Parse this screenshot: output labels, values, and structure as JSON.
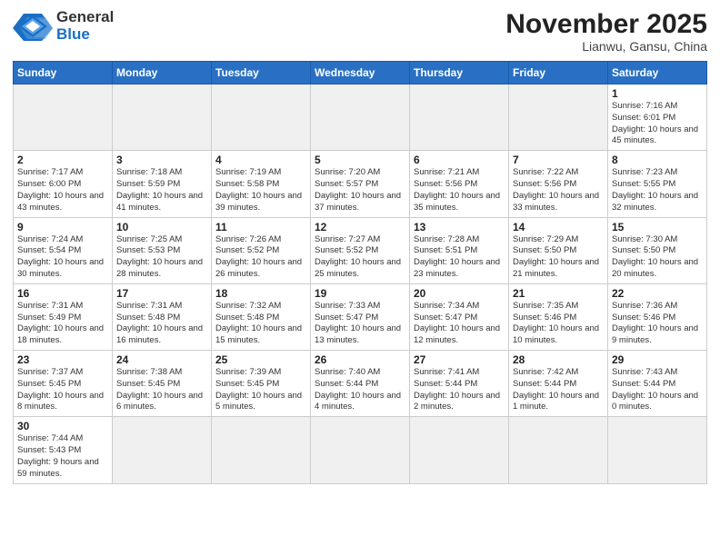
{
  "logo": {
    "general": "General",
    "blue": "Blue"
  },
  "header": {
    "month": "November 2025",
    "location": "Lianwu, Gansu, China"
  },
  "weekdays": [
    "Sunday",
    "Monday",
    "Tuesday",
    "Wednesday",
    "Thursday",
    "Friday",
    "Saturday"
  ],
  "days": [
    {
      "date": null,
      "info": ""
    },
    {
      "date": null,
      "info": ""
    },
    {
      "date": null,
      "info": ""
    },
    {
      "date": null,
      "info": ""
    },
    {
      "date": null,
      "info": ""
    },
    {
      "date": null,
      "info": ""
    },
    {
      "date": 1,
      "info": "Sunrise: 7:16 AM\nSunset: 6:01 PM\nDaylight: 10 hours and 45 minutes."
    },
    {
      "date": 2,
      "info": "Sunrise: 7:17 AM\nSunset: 6:00 PM\nDaylight: 10 hours and 43 minutes."
    },
    {
      "date": 3,
      "info": "Sunrise: 7:18 AM\nSunset: 5:59 PM\nDaylight: 10 hours and 41 minutes."
    },
    {
      "date": 4,
      "info": "Sunrise: 7:19 AM\nSunset: 5:58 PM\nDaylight: 10 hours and 39 minutes."
    },
    {
      "date": 5,
      "info": "Sunrise: 7:20 AM\nSunset: 5:57 PM\nDaylight: 10 hours and 37 minutes."
    },
    {
      "date": 6,
      "info": "Sunrise: 7:21 AM\nSunset: 5:56 PM\nDaylight: 10 hours and 35 minutes."
    },
    {
      "date": 7,
      "info": "Sunrise: 7:22 AM\nSunset: 5:56 PM\nDaylight: 10 hours and 33 minutes."
    },
    {
      "date": 8,
      "info": "Sunrise: 7:23 AM\nSunset: 5:55 PM\nDaylight: 10 hours and 32 minutes."
    },
    {
      "date": 9,
      "info": "Sunrise: 7:24 AM\nSunset: 5:54 PM\nDaylight: 10 hours and 30 minutes."
    },
    {
      "date": 10,
      "info": "Sunrise: 7:25 AM\nSunset: 5:53 PM\nDaylight: 10 hours and 28 minutes."
    },
    {
      "date": 11,
      "info": "Sunrise: 7:26 AM\nSunset: 5:52 PM\nDaylight: 10 hours and 26 minutes."
    },
    {
      "date": 12,
      "info": "Sunrise: 7:27 AM\nSunset: 5:52 PM\nDaylight: 10 hours and 25 minutes."
    },
    {
      "date": 13,
      "info": "Sunrise: 7:28 AM\nSunset: 5:51 PM\nDaylight: 10 hours and 23 minutes."
    },
    {
      "date": 14,
      "info": "Sunrise: 7:29 AM\nSunset: 5:50 PM\nDaylight: 10 hours and 21 minutes."
    },
    {
      "date": 15,
      "info": "Sunrise: 7:30 AM\nSunset: 5:50 PM\nDaylight: 10 hours and 20 minutes."
    },
    {
      "date": 16,
      "info": "Sunrise: 7:31 AM\nSunset: 5:49 PM\nDaylight: 10 hours and 18 minutes."
    },
    {
      "date": 17,
      "info": "Sunrise: 7:31 AM\nSunset: 5:48 PM\nDaylight: 10 hours and 16 minutes."
    },
    {
      "date": 18,
      "info": "Sunrise: 7:32 AM\nSunset: 5:48 PM\nDaylight: 10 hours and 15 minutes."
    },
    {
      "date": 19,
      "info": "Sunrise: 7:33 AM\nSunset: 5:47 PM\nDaylight: 10 hours and 13 minutes."
    },
    {
      "date": 20,
      "info": "Sunrise: 7:34 AM\nSunset: 5:47 PM\nDaylight: 10 hours and 12 minutes."
    },
    {
      "date": 21,
      "info": "Sunrise: 7:35 AM\nSunset: 5:46 PM\nDaylight: 10 hours and 10 minutes."
    },
    {
      "date": 22,
      "info": "Sunrise: 7:36 AM\nSunset: 5:46 PM\nDaylight: 10 hours and 9 minutes."
    },
    {
      "date": 23,
      "info": "Sunrise: 7:37 AM\nSunset: 5:45 PM\nDaylight: 10 hours and 8 minutes."
    },
    {
      "date": 24,
      "info": "Sunrise: 7:38 AM\nSunset: 5:45 PM\nDaylight: 10 hours and 6 minutes."
    },
    {
      "date": 25,
      "info": "Sunrise: 7:39 AM\nSunset: 5:45 PM\nDaylight: 10 hours and 5 minutes."
    },
    {
      "date": 26,
      "info": "Sunrise: 7:40 AM\nSunset: 5:44 PM\nDaylight: 10 hours and 4 minutes."
    },
    {
      "date": 27,
      "info": "Sunrise: 7:41 AM\nSunset: 5:44 PM\nDaylight: 10 hours and 2 minutes."
    },
    {
      "date": 28,
      "info": "Sunrise: 7:42 AM\nSunset: 5:44 PM\nDaylight: 10 hours and 1 minute."
    },
    {
      "date": 29,
      "info": "Sunrise: 7:43 AM\nSunset: 5:44 PM\nDaylight: 10 hours and 0 minutes."
    },
    {
      "date": 30,
      "info": "Sunrise: 7:44 AM\nSunset: 5:43 PM\nDaylight: 9 hours and 59 minutes."
    },
    {
      "date": null,
      "info": ""
    },
    {
      "date": null,
      "info": ""
    },
    {
      "date": null,
      "info": ""
    },
    {
      "date": null,
      "info": ""
    },
    {
      "date": null,
      "info": ""
    },
    {
      "date": null,
      "info": ""
    }
  ]
}
